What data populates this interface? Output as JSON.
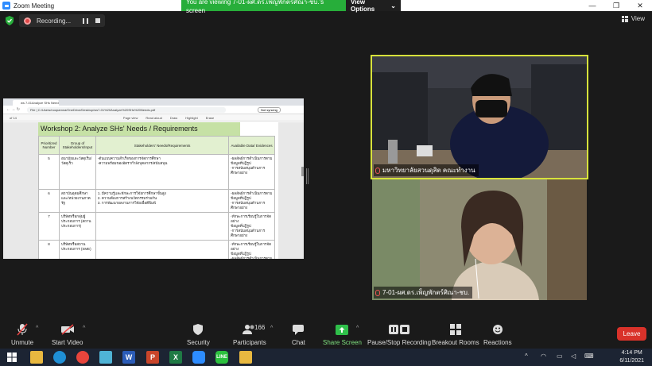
{
  "titlebar": {
    "title": "Zoom Meeting",
    "minimize": "—",
    "restore": "❐",
    "close": "✕"
  },
  "share_banner": {
    "message": "You are viewing 7-01-ผศ.ดร.เพ็ญพักตร์ศิณา-ชบ.'s screen",
    "options": "View Options",
    "options_caret": "⌄"
  },
  "recording": {
    "label": "Recording..."
  },
  "view": {
    "label": "View"
  },
  "shared_screen": {
    "tab_label": "ws 7-01Analyze SHs Needs",
    "url": "C:/Users/noopamna/OneDrive/Desktop/ws7-01%20Analyze%20SHs%20Needs.pdf",
    "file_label": "File",
    "nav": "← → ↻",
    "sync_label": "Not syncing",
    "page_counter": "of 14",
    "toolbar": [
      "Page view",
      "Read aloud",
      "Draw",
      "Highlight",
      "Erase"
    ],
    "workshop_title": "Workshop 2: Analyze SHs' Needs / Requirements",
    "table_headers": [
      "Prioritized Number",
      "Group of Stakeholders/Input",
      "Stakeholders' Needs/Requirements",
      "Available Data/ Evidences"
    ],
    "rows": [
      {
        "num": "5",
        "group": "อนามัยและวัสดุเริ่ม/ วัสดุเร็ว",
        "needs": "-ต้นแบบความสำเร็จของการจัดการศึกษา\n-ความพร้อมของอัตรากำลังบุคลากร/สนับสนุน",
        "evidence": "-ผลลัพธ์การดำเนินการตาม ข้อมูลที่ปฏิรูป\n-การสนับสนุนด้านการศึกษาอย่าง"
      },
      {
        "num": "6",
        "group": "สถาบันอุดมศึกษาและ/หน่วยงานภาครัฐ",
        "needs": "1. มีความรู้และทักษะการวิจัยการศึกษาขั้นสูง\n2. ความต้องการสร้างนวัตกรรมร่วมกัน\n3. การพัฒนาผลงานการวิจัยเพื่อตีพิมพ์",
        "evidence": "-ผลลัพธ์การดำเนินการตาม ข้อมูลที่ปฏิรูป\n-การสนับสนุนด้านการศึกษาอย่าง"
      },
      {
        "num": "7",
        "group": "บริษัทหรือกลุ่มผู้ประกอบการ (สถานประกอบการ)",
        "needs": "",
        "evidence": "-ทักษะการเรียนรู้ในการจัดอย่าง\nข้อมูลที่ปฏิรูป\n-การสนับสนุนด้านการศึกษาอย่าง"
      },
      {
        "num": "8",
        "group": "บริษัทหรือสถานประกอบการ (SME)",
        "needs": "",
        "evidence": "-ทักษะการเรียนรู้ในการจัดอย่าง\nข้อมูลที่ปฏิรูป\n-ผลลัพธ์การดำเนินการตาม\n-การสนับสนุนด้านการศึกษาอย่าง"
      }
    ]
  },
  "participants_video": [
    {
      "name": "มหาวิทยาลัยสวนดุสิต คณะทำงาน",
      "active_speaker": true
    },
    {
      "name": "7-01-ผศ.ดร.เพ็ญพักตร์ศิณา-ชบ.",
      "active_speaker": false
    }
  ],
  "toolbar": {
    "unmute": "Unmute",
    "start_video": "Start Video",
    "security": "Security",
    "participants": "Participants",
    "participants_count": "166",
    "chat": "Chat",
    "share_screen": "Share Screen",
    "pause_stop_recording": "Pause/Stop Recording",
    "breakout_rooms": "Breakout Rooms",
    "reactions": "Reactions",
    "leave": "Leave",
    "caret": "^"
  },
  "taskbar": {
    "apps": [
      "file-explorer",
      "edge",
      "chrome",
      "word",
      "powerpoint",
      "excel",
      "zoom",
      "line",
      "folder"
    ],
    "time": "4:14 PM",
    "date": "6/11/2021",
    "tray_chevron": "^"
  }
}
